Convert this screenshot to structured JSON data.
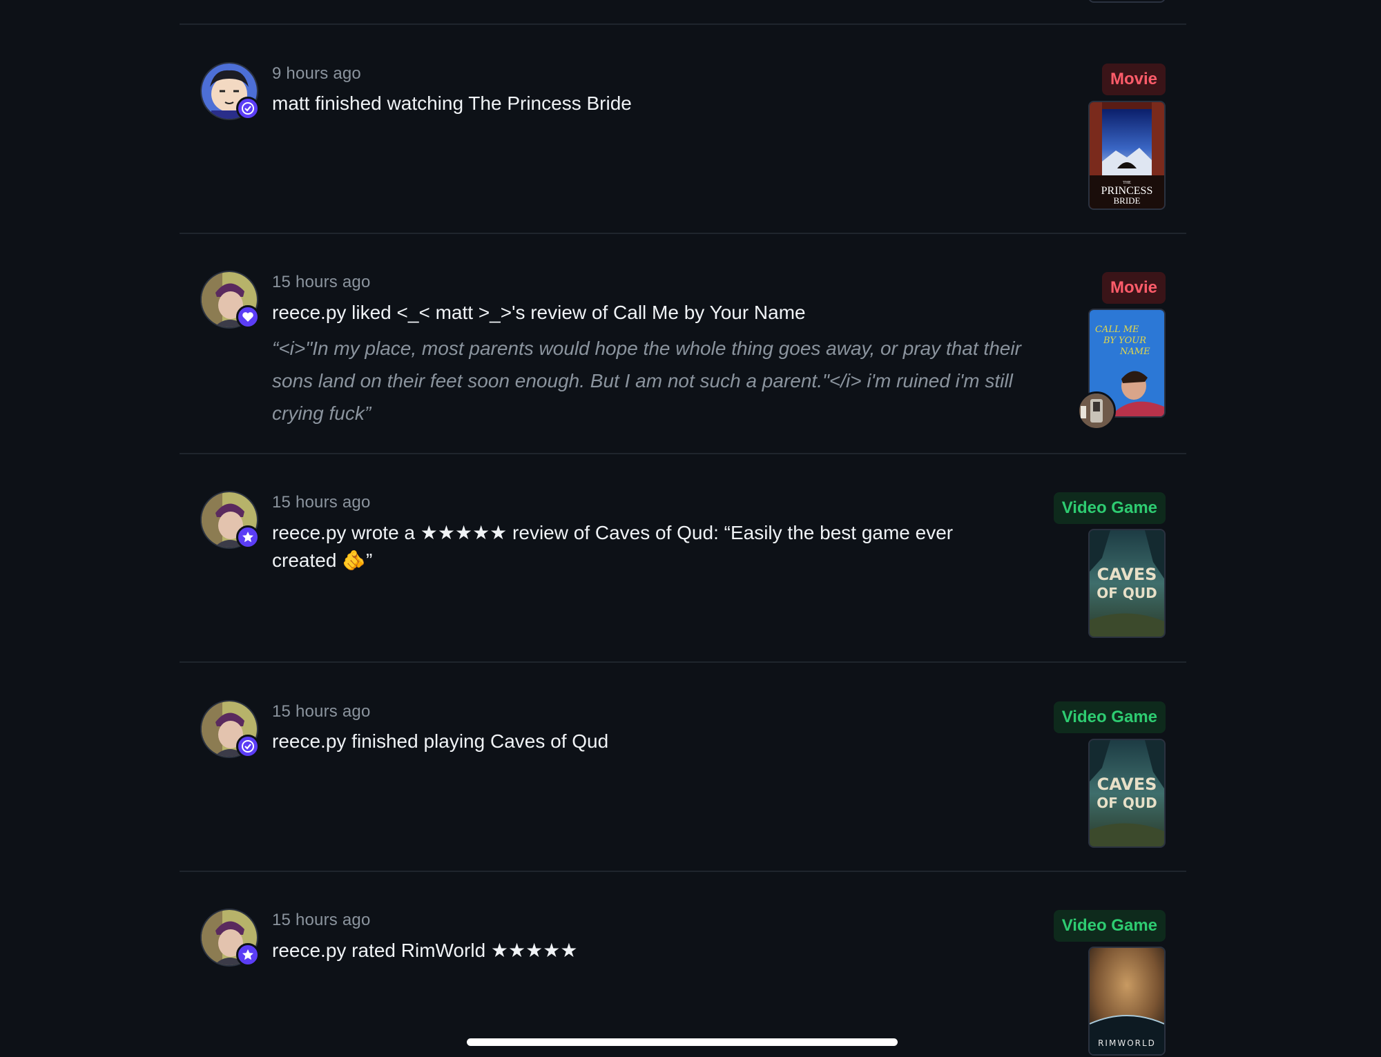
{
  "feed": {
    "items": [
      {
        "timestamp": "9 hours ago",
        "text": "matt finished watching The Princess Bride",
        "tag": "Movie",
        "tag_kind": "movie",
        "badge_icon": "check-icon",
        "poster_title": "THE PRINCESS BRIDE",
        "poster_title_top": "THE",
        "poster_title_main": "PRINCESS",
        "poster_title_bottom": "BRIDE"
      },
      {
        "timestamp": "15 hours ago",
        "text": "reece.py liked <_< matt >_>'s review of Call Me by Your Name",
        "quote": "“<i>\"In my place, most parents would hope the whole thing goes away, or pray that their sons land on their feet soon enough. But I am not such a parent.\"</i>  i'm ruined  i'm still crying fuck”",
        "tag": "Movie",
        "tag_kind": "movie",
        "badge_icon": "heart-icon",
        "poster_title": "CALL ME BY YOUR NAME",
        "poster_line1": "CALL ME",
        "poster_line2": "BY YOUR",
        "poster_line3": "NAME"
      },
      {
        "timestamp": "15 hours ago",
        "text_line1": "reece.py wrote a ★★★★★ review of Caves of Qud: “Easily the best game ever",
        "text_line2": "created 🫵”",
        "tag": "Video Game",
        "tag_kind": "game",
        "badge_icon": "star-icon",
        "poster_line1": "CAVES",
        "poster_line2": "OF QUD"
      },
      {
        "timestamp": "15 hours ago",
        "text": "reece.py finished playing Caves of Qud",
        "tag": "Video Game",
        "tag_kind": "game",
        "badge_icon": "check-icon",
        "poster_line1": "CAVES",
        "poster_line2": "OF QUD"
      },
      {
        "timestamp": "15 hours ago",
        "text": "reece.py rated RimWorld ★★★★★",
        "tag": "Video Game",
        "tag_kind": "game",
        "badge_icon": "star-icon",
        "poster_title": "RIMWORLD"
      }
    ]
  },
  "colors": {
    "background": "#0d1117",
    "badge": "#5b3df5",
    "movie_tag_text": "#ff5c6a",
    "game_tag_text": "#2ecc71",
    "timestamp": "#8b949e"
  }
}
